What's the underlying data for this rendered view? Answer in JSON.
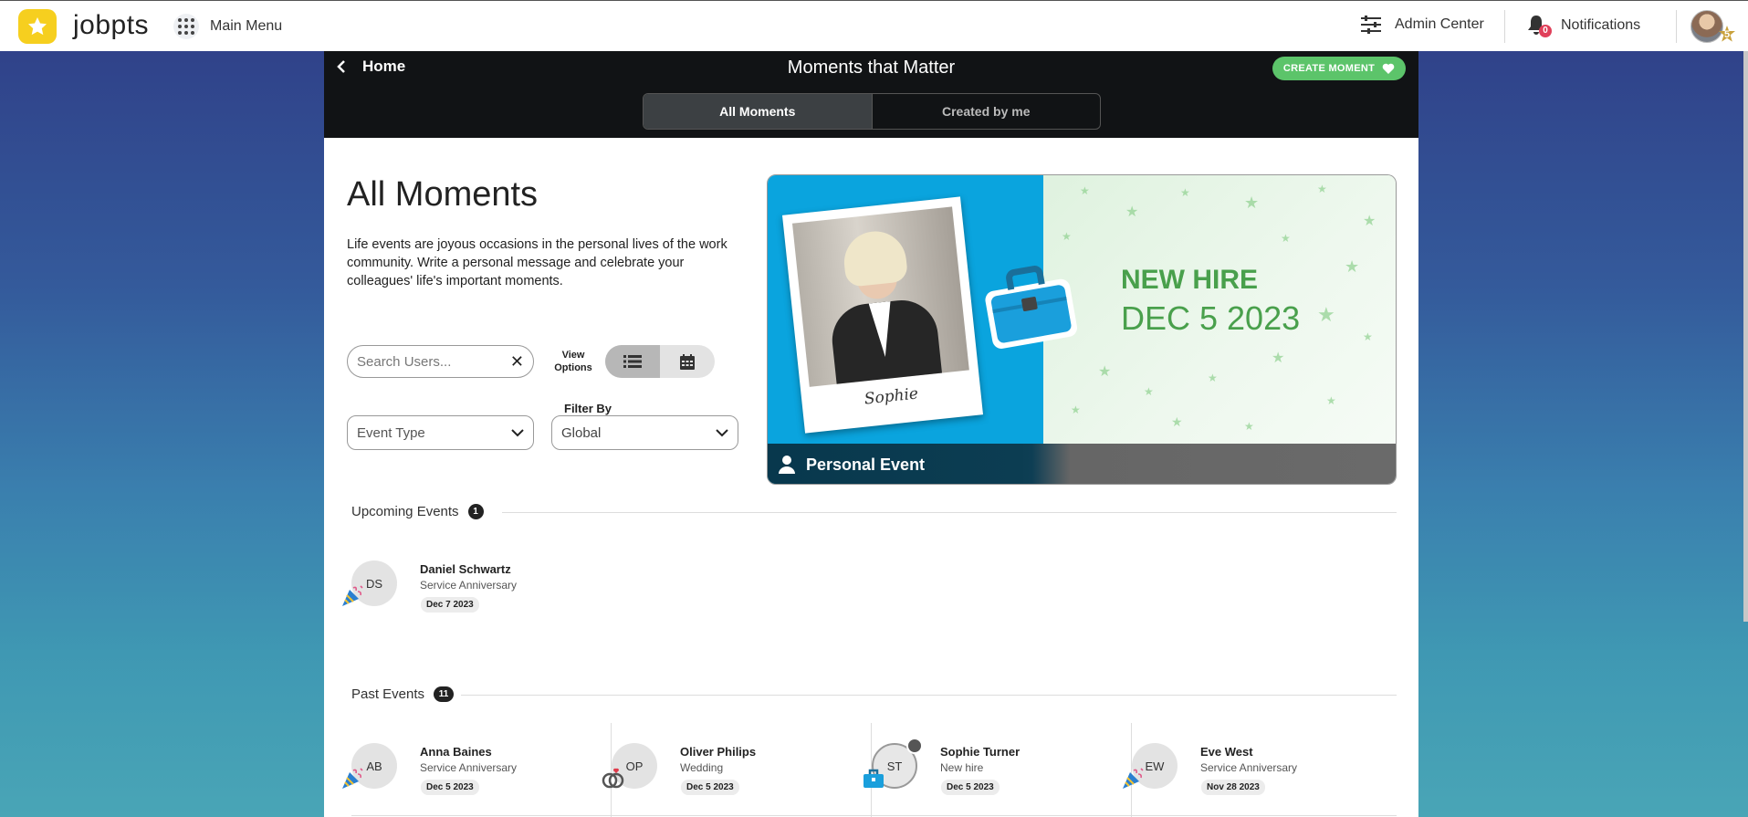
{
  "topbar": {
    "logo_text": "jobpts",
    "main_menu": "Main Menu",
    "admin_center": "Admin Center",
    "notifications_label": "Notifications",
    "notification_count": "0",
    "user_level": "5"
  },
  "header": {
    "back_label": "Home",
    "title": "Moments that Matter",
    "create_button": "CREATE MOMENT",
    "tabs": [
      {
        "label": "All Moments",
        "active": true
      },
      {
        "label": "Created by me",
        "active": false
      }
    ]
  },
  "intro": {
    "title": "All Moments",
    "description": "Life events are joyous occasions in the personal lives of the work community. Write a personal message and celebrate your colleagues' life's important moments."
  },
  "filters": {
    "search_placeholder": "Search Users...",
    "view_options_label": "View Options",
    "view_mode": "list",
    "event_type_placeholder": "Event Type",
    "filter_by_label": "Filter By",
    "filter_by_value": "Global"
  },
  "banner": {
    "name": "Sophie",
    "headline": "NEW HIRE",
    "date": "DEC 5 2023",
    "footer": "Personal Event",
    "colors": {
      "left": "#0aa4de",
      "accent": "#49a04c"
    }
  },
  "upcoming": {
    "label": "Upcoming Events",
    "count": "1",
    "items": [
      {
        "initials": "DS",
        "name": "Daniel Schwartz",
        "type": "Service Anniversary",
        "date": "Dec 7 2023",
        "icon": "party-popper-icon"
      }
    ]
  },
  "past": {
    "label": "Past Events",
    "count": "11",
    "items": [
      {
        "initials": "AB",
        "name": "Anna Baines",
        "type": "Service Anniversary",
        "date": "Dec 5 2023",
        "icon": "party-popper-icon"
      },
      {
        "initials": "OP",
        "name": "Oliver Philips",
        "type": "Wedding",
        "date": "Dec 5 2023",
        "icon": "wedding-rings-icon"
      },
      {
        "initials": "ST",
        "name": "Sophie Turner",
        "type": "New hire",
        "date": "Dec 5 2023",
        "icon": "briefcase-icon"
      },
      {
        "initials": "EW",
        "name": "Eve West",
        "type": "Service Anniversary",
        "date": "Nov 28 2023",
        "icon": "party-popper-icon"
      }
    ]
  }
}
